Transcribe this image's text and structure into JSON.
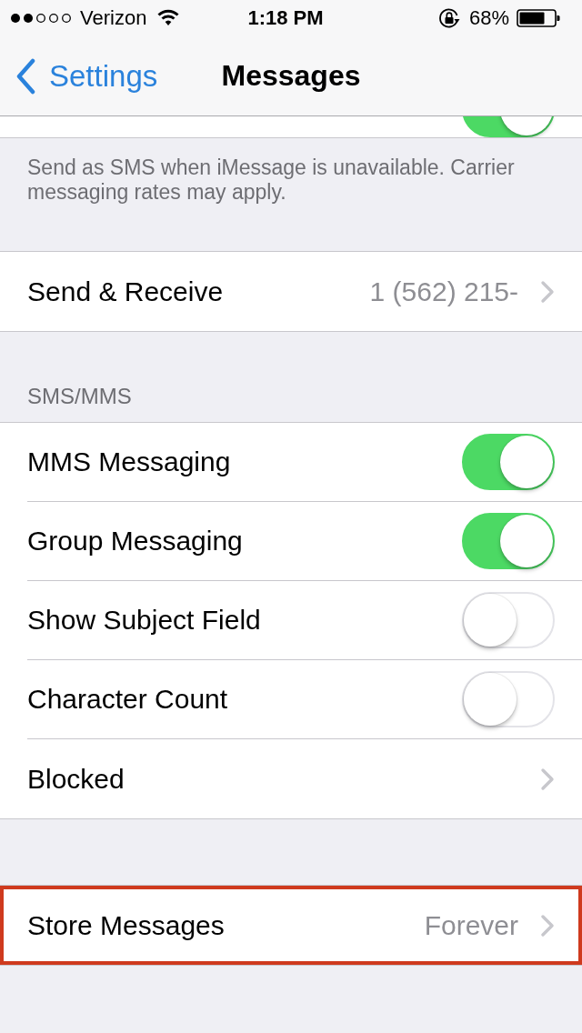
{
  "status_bar": {
    "carrier": "Verizon",
    "time": "1:18 PM",
    "battery": "68%"
  },
  "nav_bar": {
    "back": "Settings",
    "title": "Messages"
  },
  "scrolled_row": {
    "kind": "toggle",
    "on": true
  },
  "sections": [
    {
      "footer": "Send as SMS when iMessage is unavailable. Carrier messaging rates may apply."
    },
    {
      "rows": [
        {
          "kind": "link",
          "label": "Send & Receive",
          "value": "1 (562) 215-",
          "highlighted": false
        }
      ]
    },
    {
      "header": "SMS/MMS",
      "rows": [
        {
          "kind": "toggle",
          "label": "MMS Messaging",
          "on": true,
          "highlighted": false
        },
        {
          "kind": "toggle",
          "label": "Group Messaging",
          "on": true,
          "highlighted": false
        },
        {
          "kind": "toggle",
          "label": "Show Subject Field",
          "on": false,
          "highlighted": false
        },
        {
          "kind": "toggle",
          "label": "Character Count",
          "on": false,
          "highlighted": false
        },
        {
          "kind": "link",
          "label": "Blocked",
          "highlighted": false
        }
      ]
    },
    {
      "rows": [
        {
          "kind": "link",
          "label": "Store Messages",
          "value": "Forever",
          "highlighted": true
        }
      ]
    }
  ]
}
